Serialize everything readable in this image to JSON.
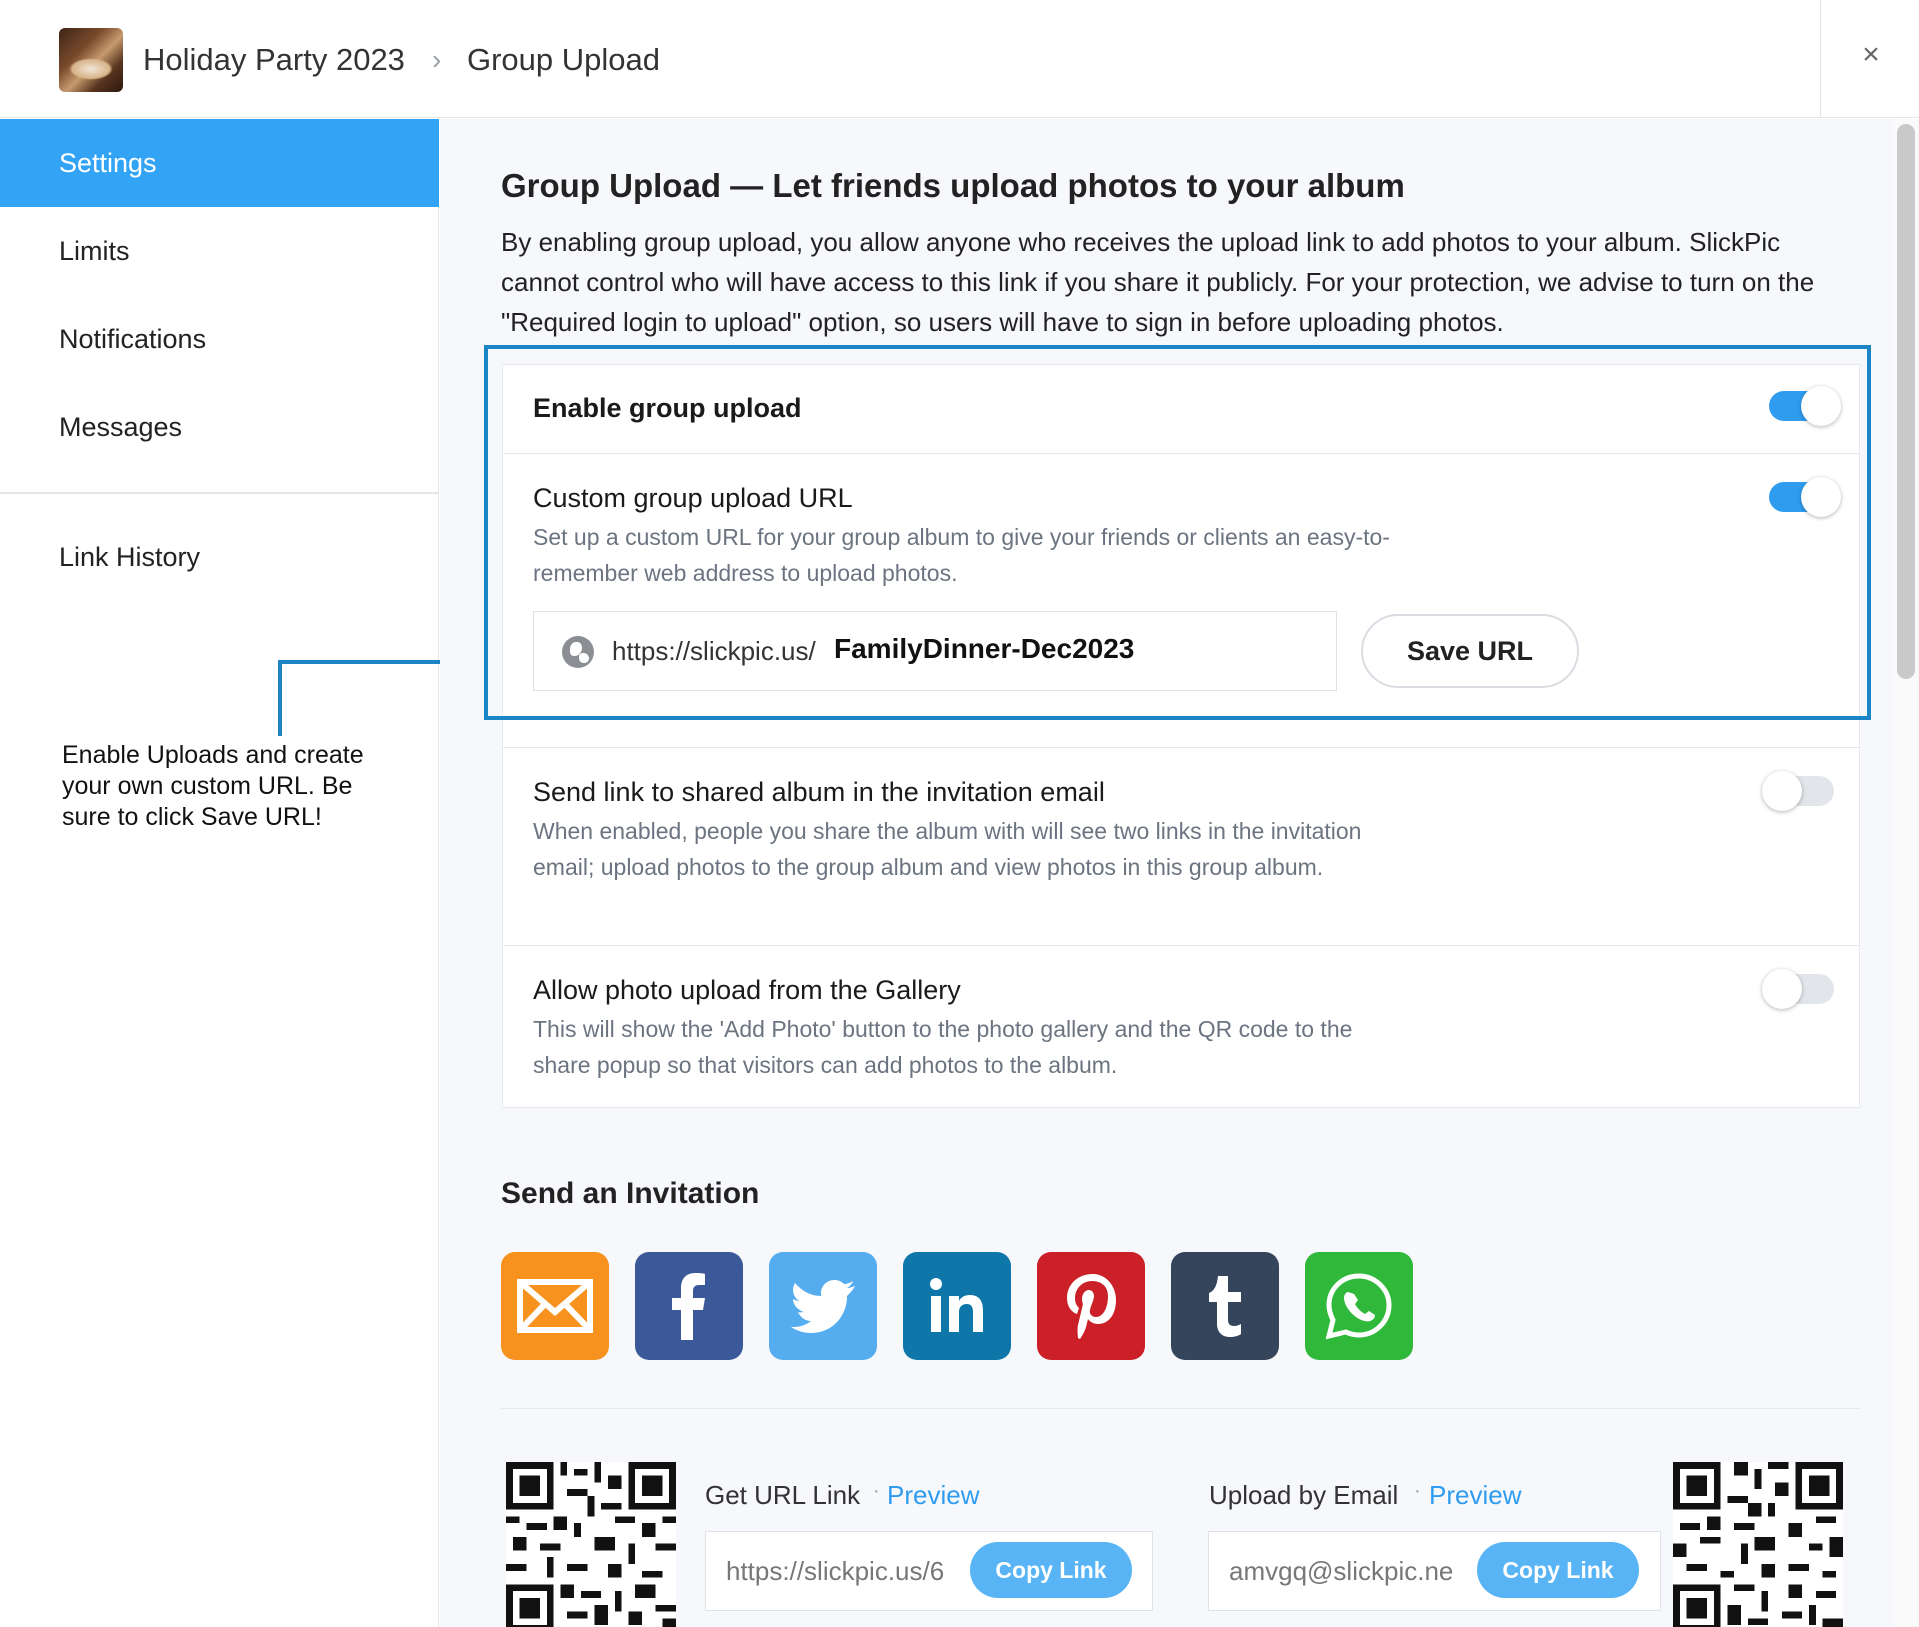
{
  "header": {
    "breadcrumb": [
      "Holiday Party 2023",
      "Group Upload"
    ],
    "separator": "›",
    "close_glyph": "×"
  },
  "sidebar": {
    "items": [
      {
        "label": "Settings",
        "active": true
      },
      {
        "label": "Limits",
        "active": false
      },
      {
        "label": "Notifications",
        "active": false
      },
      {
        "label": "Messages",
        "active": false
      }
    ],
    "secondary": [
      {
        "label": "Link History"
      }
    ]
  },
  "annotation": {
    "text": "Enable Uploads and create your own custom URL. Be sure to click Save URL!"
  },
  "main": {
    "title": "Group Upload — Let friends upload photos to your album",
    "intro": "By enabling group upload, you allow anyone who receives the upload link to add photos to your album. SlickPic cannot control who will have access to this link if you share it publicly. For your protection, we advise to turn on the \"Required login to upload\" option, so users will have to sign in before uploading photos.",
    "settings": [
      {
        "title": "Enable group upload",
        "enabled": true
      },
      {
        "title": "Custom group upload URL",
        "description": "Set up a custom URL for your group album to give your friends or clients an easy-to-remember web address to upload photos.",
        "enabled": true
      },
      {
        "title": "Send link to shared album in the invitation email",
        "description": "When enabled, people you share the album with will see two links in the invitation email; upload photos to the group album and view photos in this group album.",
        "enabled": false
      },
      {
        "title": "Allow photo upload from the Gallery",
        "description": "This will show the 'Add Photo' button to the photo gallery and the QR code to the share popup so that visitors can add photos to the album.",
        "enabled": false
      }
    ],
    "custom_url": {
      "prefix": "https://slickpic.us/",
      "slug": "FamilyDinner-Dec2023",
      "save_label": "Save URL"
    },
    "invitation": {
      "title": "Send an Invitation",
      "channels": [
        {
          "name": "email",
          "icon": "envelope-icon",
          "color": "#f7921e"
        },
        {
          "name": "facebook",
          "icon": "facebook-icon",
          "color": "#3b5998"
        },
        {
          "name": "twitter",
          "icon": "twitter-bird-icon",
          "color": "#55acee"
        },
        {
          "name": "linkedin",
          "icon": "linkedin-icon",
          "color": "#0e76a8"
        },
        {
          "name": "pinterest",
          "icon": "pinterest-icon",
          "color": "#cb2027"
        },
        {
          "name": "tumblr",
          "icon": "tumblr-icon",
          "color": "#35465c"
        },
        {
          "name": "whatsapp",
          "icon": "whatsapp-icon",
          "color": "#2fb83a"
        }
      ]
    },
    "url_link": {
      "label": "Get URL Link",
      "preview": "Preview",
      "value": "https://slickpic.us/6",
      "copy_label": "Copy Link"
    },
    "email_link": {
      "label": "Upload by Email",
      "preview": "Preview",
      "value": "amvgq@slickpic.ne",
      "copy_label": "Copy Link"
    },
    "dot": "·"
  },
  "colors": {
    "accent": "#2f9cf0",
    "active_nav": "#33a4f5",
    "annotation": "#1d84c6"
  }
}
